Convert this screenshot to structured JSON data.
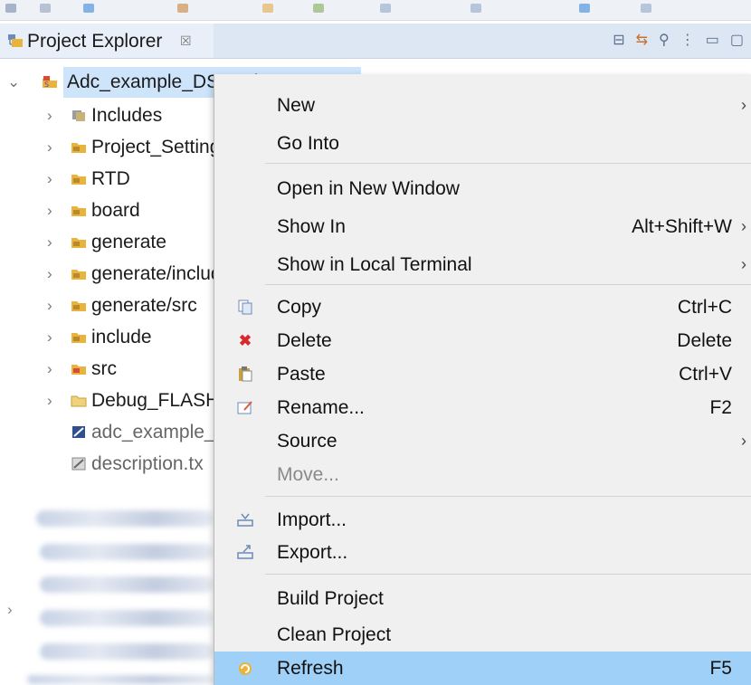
{
  "panel": {
    "title": "Project Explorer",
    "close_glyph": "☒",
    "tool_icons": [
      "collapse-all-icon",
      "link-with-editor-icon",
      "filter-icon",
      "view-menu-icon",
      "minimize-icon",
      "maximize-icon"
    ],
    "tool_glyphs": [
      "⊟",
      "⇆",
      "⚲",
      "⋮",
      "▭",
      "▢"
    ]
  },
  "tree": {
    "root": {
      "label": "Adc_example_DS: Debug_FLASH",
      "expanded": true
    },
    "items": [
      {
        "label": "Includes",
        "icon": "includes-icon"
      },
      {
        "label": "Project_Settings",
        "icon": "source-folder-icon"
      },
      {
        "label": "RTD",
        "icon": "source-folder-icon"
      },
      {
        "label": "board",
        "icon": "source-folder-icon"
      },
      {
        "label": "generate",
        "icon": "source-folder-icon"
      },
      {
        "label": "generate/include",
        "icon": "source-folder-icon"
      },
      {
        "label": "generate/src",
        "icon": "source-folder-icon"
      },
      {
        "label": "include",
        "icon": "source-folder-icon"
      },
      {
        "label": "src",
        "icon": "source-folder-icon"
      },
      {
        "label": "Debug_FLASH",
        "icon": "folder-icon"
      },
      {
        "label": "adc_example_",
        "icon": "mex-file-icon",
        "muted": true
      },
      {
        "label": "description.tx",
        "icon": "text-file-icon",
        "muted": true
      }
    ]
  },
  "menu": {
    "items": [
      {
        "label": "New",
        "submenu": true
      },
      {
        "label": "Go Into"
      },
      {
        "label": "Open in New Window"
      },
      {
        "label": "Show In",
        "shortcut": "Alt+Shift+W",
        "submenu": true
      },
      {
        "label": "Show in Local Terminal",
        "submenu": true
      },
      {
        "label": "Copy",
        "shortcut": "Ctrl+C",
        "icon": "copy-icon"
      },
      {
        "label": "Delete",
        "shortcut": "Delete",
        "icon": "delete-icon"
      },
      {
        "label": "Paste",
        "shortcut": "Ctrl+V",
        "icon": "paste-icon"
      },
      {
        "label": "Rename...",
        "shortcut": "F2",
        "icon": "rename-icon"
      },
      {
        "label": "Source",
        "submenu": true
      },
      {
        "label": "Move...",
        "disabled": true
      },
      {
        "label": "Import...",
        "icon": "import-icon"
      },
      {
        "label": "Export...",
        "icon": "export-icon"
      },
      {
        "label": "Build Project"
      },
      {
        "label": "Clean Project"
      },
      {
        "label": "Refresh",
        "shortcut": "F5",
        "icon": "refresh-icon",
        "highlighted": true
      }
    ],
    "submenu_glyph": "›"
  },
  "colors": {
    "highlight": "#9fd0f7",
    "root_selection": "#cde4fb",
    "delete_red": "#d9272e",
    "folder_yellow": "#e8b43c",
    "menu_bg": "#f0f0f0"
  }
}
